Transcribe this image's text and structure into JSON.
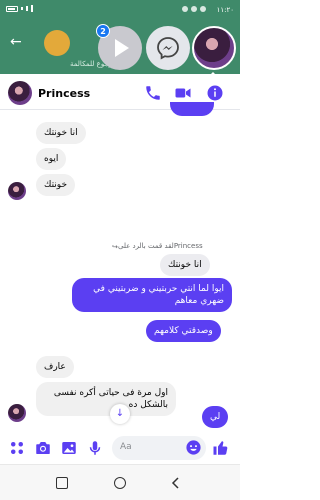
{
  "status_bar": {
    "time": "١١:٢٠"
  },
  "background_app": {
    "text": "الرجوع للمكالمة"
  },
  "chat_heads": {
    "badge_count": "2"
  },
  "chat_header": {
    "contact_name": "Princess"
  },
  "messages": {
    "m1": "انا خونتك",
    "m2": "ايوه",
    "m3": "خونتك",
    "reply_note": "Princessلقد قمت بالرد على",
    "m4": "انا خونتك",
    "m5": "ايوا لما انتي حربتيني و ضربتيني في ضهري معاهم",
    "m6": "وصدقتي كلامهم",
    "m7": "عارف",
    "m8": "اول مرة فى حياتى أكره نفسى بالشكل ده",
    "m9": "لي"
  },
  "composer": {
    "placeholder": "Aa"
  },
  "colors": {
    "accent": "#5b3ff2",
    "bg_app": "#3f8a6a",
    "received_bubble": "#f0f0f0"
  },
  "icons": [
    "back-arrow-icon",
    "play-icon",
    "messenger-icon",
    "phone-icon",
    "video-camera-icon",
    "info-icon",
    "reply-arrow-icon",
    "chevron-down-icon",
    "more-dots-icon",
    "camera-icon",
    "gallery-icon",
    "microphone-icon",
    "emoji-icon",
    "thumbs-up-icon"
  ]
}
